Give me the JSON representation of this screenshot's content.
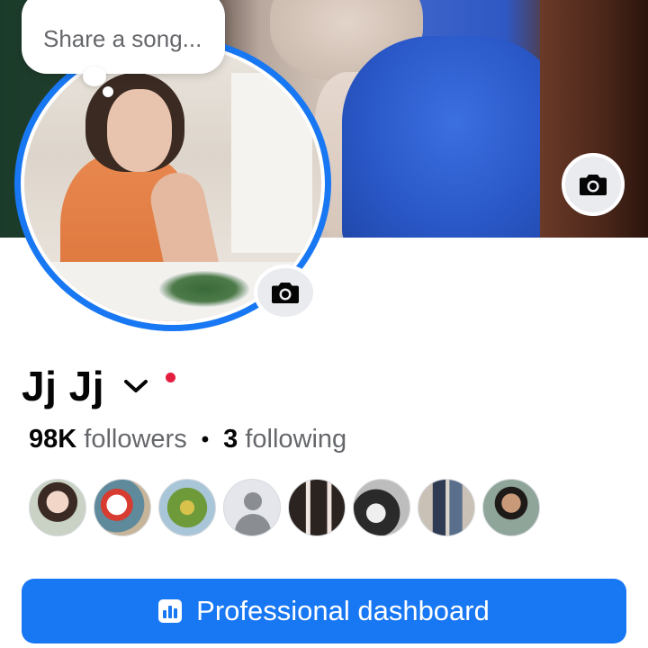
{
  "profile": {
    "name": "Jj Jj",
    "song_prompt": "Share a song...",
    "followers_count": "98K",
    "followers_label": "followers",
    "separator": "•",
    "following_count": "3",
    "following_label": "following"
  },
  "friends": [
    {
      "name": "friend-1"
    },
    {
      "name": "friend-2"
    },
    {
      "name": "friend-3"
    },
    {
      "name": "friend-4"
    },
    {
      "name": "friend-5"
    },
    {
      "name": "friend-6"
    },
    {
      "name": "friend-7"
    },
    {
      "name": "friend-8"
    }
  ],
  "actions": {
    "dashboard_label": "Professional dashboard"
  },
  "icons": {
    "cover_camera": "camera-icon",
    "avatar_camera": "camera-icon",
    "name_menu": "chevron-down-icon",
    "dashboard": "bar-chart-icon",
    "placeholder_avatar": "person-icon"
  },
  "colors": {
    "accent": "#1877f2",
    "status_dot": "#e41e3f",
    "secondary_text": "#65676b"
  }
}
